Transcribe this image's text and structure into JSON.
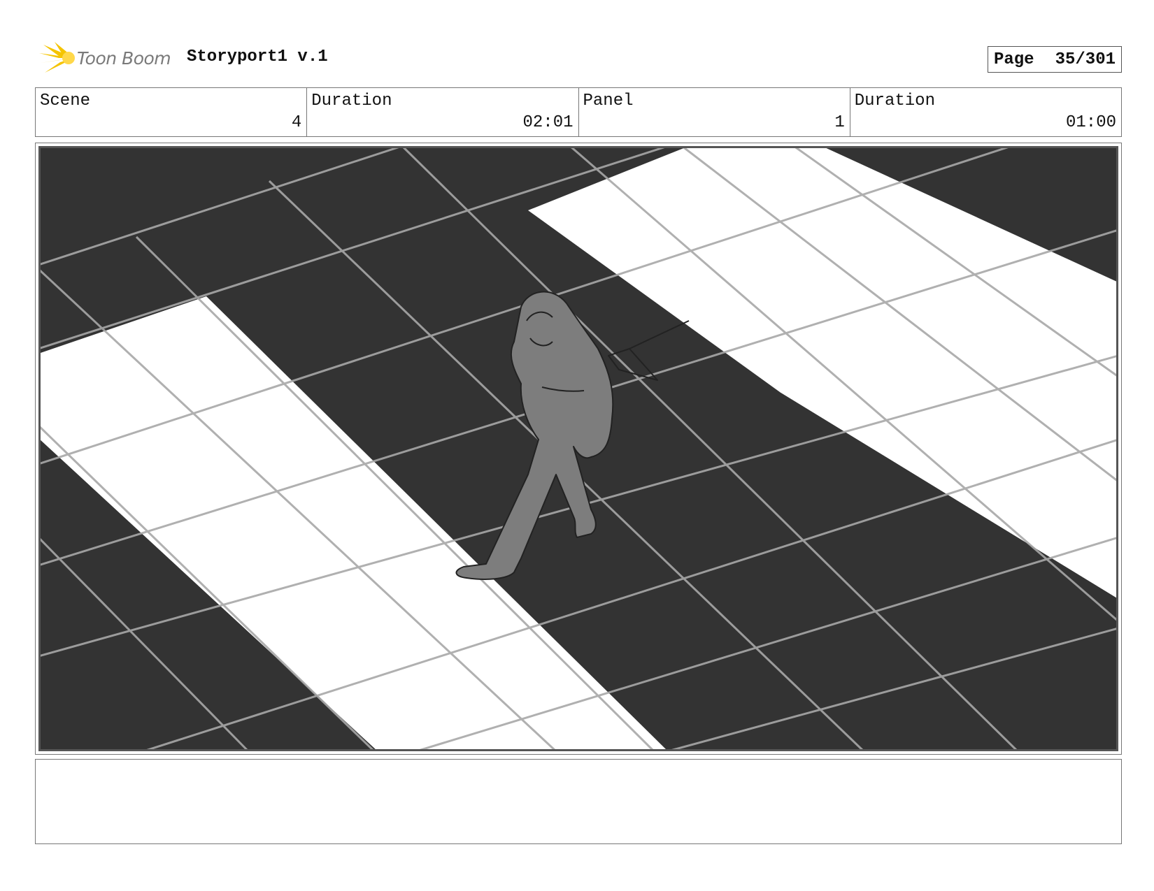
{
  "header": {
    "logo_text": "Toon Boom",
    "project_title": "Storyport1 v.1",
    "page_label": "Page",
    "page_value": "35/301"
  },
  "info": {
    "scene_label": "Scene",
    "scene_value": "4",
    "scene_duration_label": "Duration",
    "scene_duration_value": "02:01",
    "panel_label": "Panel",
    "panel_value": "1",
    "panel_duration_label": "Duration",
    "panel_duration_value": "01:00"
  },
  "notes": {
    "text": ""
  },
  "colors": {
    "dark_tile": "#333333",
    "light_tile": "#ffffff",
    "grid_line": "#a8a8a8",
    "figure": "#7d7d7d",
    "logo_yellow": "#f5c400"
  }
}
